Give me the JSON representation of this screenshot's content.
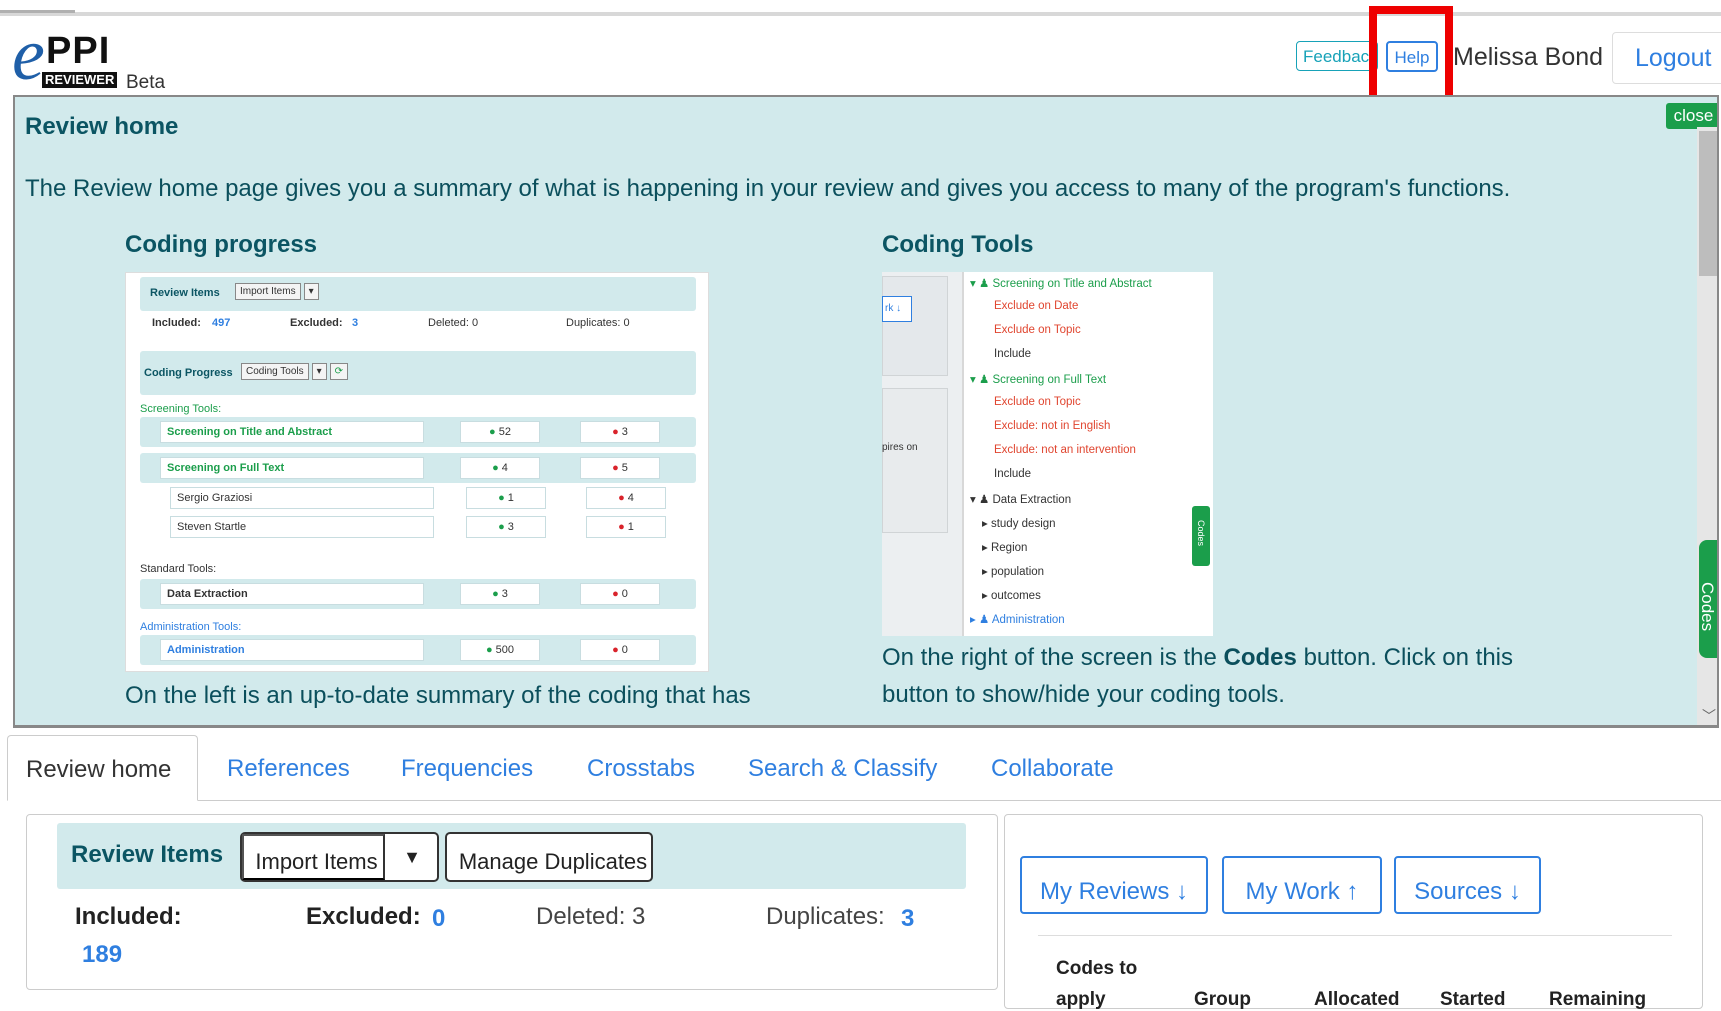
{
  "header": {
    "logo_e": "e",
    "logo_ppi": "PPI",
    "logo_reviewer": "REVIEWER",
    "logo_beta": "Beta",
    "feedback_label": "Feedback",
    "help_label": "Help",
    "user_name": "Melissa Bond",
    "logout_label": "Logout"
  },
  "help_panel": {
    "title": "Review home",
    "intro": "The Review home page gives you a summary of what is happening in your review and gives you access to many of the program's functions.",
    "close_label": "close",
    "codes_tab_label": "Codes",
    "coding_progress": {
      "title": "Coding progress",
      "caption": "On the left is an up-to-date summary of the coding that has"
    },
    "coding_tools": {
      "title": "Coding Tools",
      "caption_1": "On the right of the screen is the",
      "caption_bold": "Codes",
      "caption_2": "button. Click on this",
      "caption_3": "button to show/hide your coding tools."
    },
    "cp_image": {
      "review_items": "Review Items",
      "import_items": "Import Items",
      "included_label": "Included:",
      "included_val": "497",
      "excluded_label": "Excluded:",
      "excluded_val": "3",
      "deleted": "Deleted: 0",
      "duplicates": "Duplicates: 0",
      "coding_progress": "Coding Progress",
      "coding_tools": "Coding Tools",
      "screening_tools": "Screening Tools:",
      "rows": [
        {
          "name": "Screening on Title and Abstract",
          "ok": "52",
          "no": "3"
        },
        {
          "name": "Screening on Full Text",
          "ok": "4",
          "no": "5"
        },
        {
          "name": "Sergio Graziosi",
          "ok": "1",
          "no": "4"
        },
        {
          "name": "Steven Startle",
          "ok": "3",
          "no": "1"
        },
        {
          "name": "Data Extraction",
          "ok": "3",
          "no": "0"
        },
        {
          "name": "Administration",
          "ok": "500",
          "no": "0"
        }
      ],
      "standard_tools": "Standard Tools:",
      "admin_tools": "Administration Tools:"
    },
    "ct_image": {
      "left_btn": "rk ↓",
      "left_text": "pires on",
      "codes_mini": "Codes",
      "lines": [
        "Screening on Title and Abstract",
        "Exclude on Date",
        "Exclude on Topic",
        "Include",
        "Screening on Full Text",
        "Exclude on Topic",
        "Exclude: not in English",
        "Exclude: not an intervention",
        "Include",
        "Data Extraction",
        "study design",
        "Region",
        "population",
        "outcomes",
        "Administration"
      ]
    }
  },
  "tabs": [
    "Review home",
    "References",
    "Frequencies",
    "Crosstabs",
    "Search & Classify",
    "Collaborate"
  ],
  "review_items": {
    "title": "Review Items",
    "import_label": "Import Items",
    "import_caret": "▼",
    "duplicates_btn": "Manage Duplicates",
    "included_label": "Included:",
    "included_val": "189",
    "excluded_label": "Excluded:",
    "excluded_val": "0",
    "deleted": "Deleted: 3",
    "duplicates_label": "Duplicates:",
    "duplicates_val": "3"
  },
  "right_panel": {
    "my_reviews": "My Reviews ↓",
    "my_work": "My Work ↑",
    "sources": "Sources ↓",
    "columns": [
      "Codes to",
      "apply",
      "Group",
      "Allocated",
      "Started",
      "Remaining"
    ]
  }
}
